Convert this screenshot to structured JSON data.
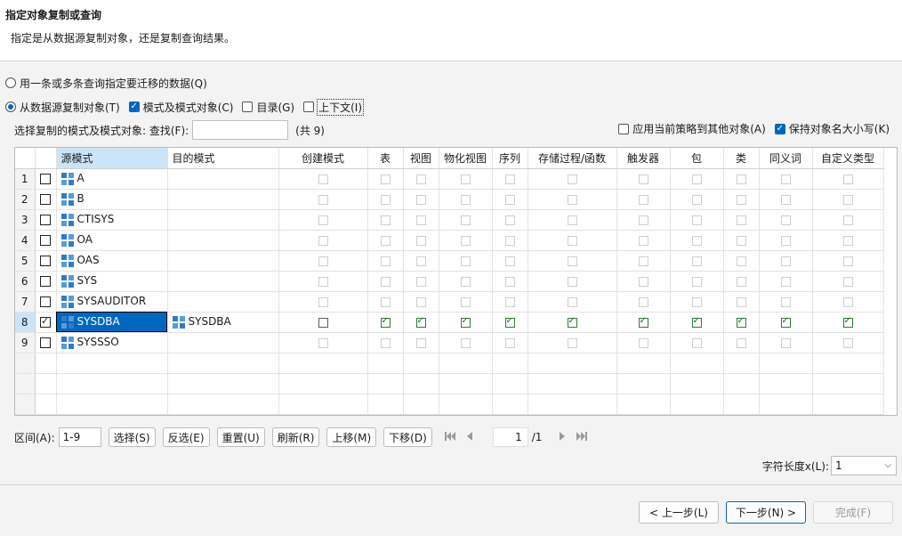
{
  "header": {
    "title": "指定对象复制或查询",
    "description": "指定是从数据源复制对象，还是复制查询结果。"
  },
  "options": {
    "query_radio": "用一条或多条查询指定要迁移的数据(Q)",
    "copy_radio": "从数据源复制对象(T)",
    "schema_objects": "模式及模式对象(C)",
    "catalog": "目录(G)",
    "context": "上下文(I)"
  },
  "find": {
    "label": "选择复制的模式及模式对象:  查找(F):",
    "value": "",
    "count": "(共 9)"
  },
  "right_options": {
    "apply_policy": "应用当前策略到其他对象(A)",
    "keep_case": "保持对象名大小写(K)"
  },
  "table": {
    "columns": [
      "源模式",
      "目的模式",
      "创建模式",
      "表",
      "视图",
      "物化视图",
      "序列",
      "存储过程/函数",
      "触发器",
      "包",
      "类",
      "同义词",
      "自定义类型"
    ],
    "rows": [
      {
        "num": "1",
        "source": "A",
        "target": "",
        "checked": false
      },
      {
        "num": "2",
        "source": "B",
        "target": "",
        "checked": false
      },
      {
        "num": "3",
        "source": "CTISYS",
        "target": "",
        "checked": false
      },
      {
        "num": "4",
        "source": "OA",
        "target": "",
        "checked": false
      },
      {
        "num": "5",
        "source": "OAS",
        "target": "",
        "checked": false
      },
      {
        "num": "6",
        "source": "SYS",
        "target": "",
        "checked": false
      },
      {
        "num": "7",
        "source": "SYSAUDITOR",
        "target": "",
        "checked": false
      },
      {
        "num": "8",
        "source": "SYSDBA",
        "target": "SYSDBA",
        "checked": true
      },
      {
        "num": "9",
        "source": "SYSSSO",
        "target": "",
        "checked": false
      }
    ]
  },
  "bottom": {
    "range_label": "区间(A):",
    "range_value": "1-9",
    "select_btn": "选择(S)",
    "invert_btn": "反选(E)",
    "reset_btn": "重置(U)",
    "refresh_btn": "刷新(R)",
    "up_btn": "上移(M)",
    "down_btn": "下移(D)",
    "page_value": "1",
    "page_total": "/1"
  },
  "charlen": {
    "label": "字符长度x(L):",
    "value": "1"
  },
  "footer": {
    "prev": "< 上一步(L)",
    "next": "下一步(N) >",
    "finish": "完成(F)"
  },
  "colors": {
    "accent": "#0067c0",
    "selected_row": "#cce4f7"
  }
}
